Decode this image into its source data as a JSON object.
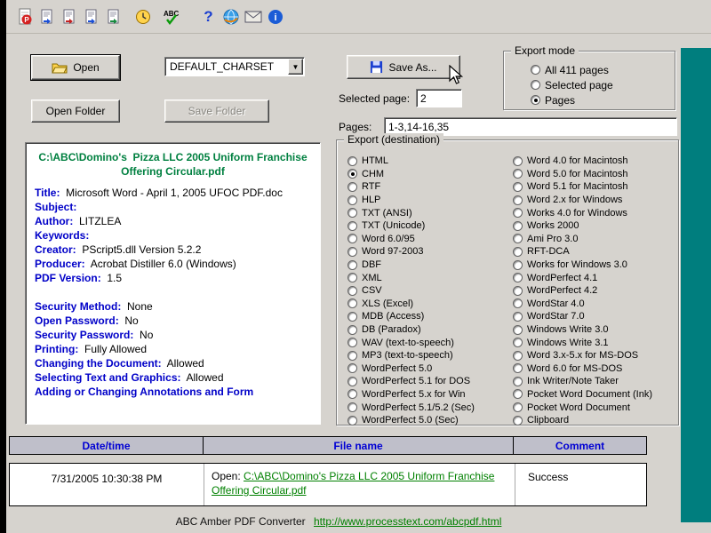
{
  "colors": {
    "desktop": "#008080",
    "window": "#d6d3ce",
    "info_label_blue": "#0000c8",
    "link_green": "#008000",
    "header_blue": "#0000d4"
  },
  "toolbar": {
    "icons": [
      "pdf-file-icon",
      "export-doc-icon-1",
      "export-doc-icon-2",
      "export-doc-icon-3",
      "export-doc-icon-4",
      "history-clock-icon",
      "spellcheck-abc-icon",
      "help-icon",
      "home-globe-icon",
      "mail-icon",
      "about-icon"
    ]
  },
  "controls": {
    "open": "Open",
    "open_folder": "Open Folder",
    "save_folder": "Save Folder",
    "save_as": "Save As...",
    "charset_value": "DEFAULT_CHARSET",
    "selected_page_label": "Selected page:",
    "selected_page_value": "2",
    "pages_label": "Pages:",
    "pages_value": "1-3,14-16,35"
  },
  "export_mode": {
    "legend": "Export mode",
    "options": [
      {
        "label": "All 411 pages",
        "selected": false
      },
      {
        "label": "Selected page",
        "selected": false
      },
      {
        "label": "Pages",
        "selected": true
      }
    ]
  },
  "export_destination": {
    "legend": "Export (destination)",
    "col1": [
      {
        "label": "HTML",
        "selected": false
      },
      {
        "label": "CHM",
        "selected": true
      },
      {
        "label": "RTF",
        "selected": false
      },
      {
        "label": "HLP",
        "selected": false
      },
      {
        "label": "TXT (ANSI)",
        "selected": false
      },
      {
        "label": "TXT (Unicode)",
        "selected": false
      },
      {
        "label": "Word 6.0/95",
        "selected": false
      },
      {
        "label": "Word 97-2003",
        "selected": false
      },
      {
        "label": "DBF",
        "selected": false
      },
      {
        "label": "XML",
        "selected": false
      },
      {
        "label": "CSV",
        "selected": false
      },
      {
        "label": "XLS (Excel)",
        "selected": false
      },
      {
        "label": "MDB (Access)",
        "selected": false
      },
      {
        "label": "DB (Paradox)",
        "selected": false
      },
      {
        "label": "WAV (text-to-speech)",
        "selected": false
      },
      {
        "label": "MP3 (text-to-speech)",
        "selected": false
      },
      {
        "label": "WordPerfect 5.0",
        "selected": false
      },
      {
        "label": "WordPerfect 5.1 for DOS",
        "selected": false
      },
      {
        "label": "WordPerfect 5.x for Win",
        "selected": false
      },
      {
        "label": "WordPerfect 5.1/5.2 (Sec)",
        "selected": false
      },
      {
        "label": "WordPerfect 5.0 (Sec)",
        "selected": false
      }
    ],
    "col2": [
      {
        "label": "Word 4.0 for Macintosh",
        "selected": false
      },
      {
        "label": "Word 5.0 for Macintosh",
        "selected": false
      },
      {
        "label": "Word 5.1 for Macintosh",
        "selected": false
      },
      {
        "label": "Word 2.x for Windows",
        "selected": false
      },
      {
        "label": "Works 4.0 for Windows",
        "selected": false
      },
      {
        "label": "Works 2000",
        "selected": false
      },
      {
        "label": "Ami Pro 3.0",
        "selected": false
      },
      {
        "label": "RFT-DCA",
        "selected": false
      },
      {
        "label": "Works for Windows 3.0",
        "selected": false
      },
      {
        "label": "WordPerfect 4.1",
        "selected": false
      },
      {
        "label": "WordPerfect 4.2",
        "selected": false
      },
      {
        "label": "WordStar 4.0",
        "selected": false
      },
      {
        "label": "WordStar 7.0",
        "selected": false
      },
      {
        "label": "Windows Write 3.0",
        "selected": false
      },
      {
        "label": "Windows Write 3.1",
        "selected": false
      },
      {
        "label": "Word 3.x-5.x for MS-DOS",
        "selected": false
      },
      {
        "label": "Word 6.0 for MS-DOS",
        "selected": false
      },
      {
        "label": "Ink Writer/Note Taker",
        "selected": false
      },
      {
        "label": "Pocket Word Document (Ink)",
        "selected": false
      },
      {
        "label": "Pocket Word Document",
        "selected": false
      },
      {
        "label": "Clipboard",
        "selected": false
      }
    ]
  },
  "info_panel": {
    "path": "C:\\ABC\\Domino's  Pizza LLC 2005 Uniform Franchise Offering Circular.pdf",
    "fields": [
      {
        "label": "Title:",
        "value": "Microsoft Word - April 1, 2005 UFOC PDF.doc"
      },
      {
        "label": "Subject:",
        "value": ""
      },
      {
        "label": "Author:",
        "value": "LITZLEA"
      },
      {
        "label": "Keywords:",
        "value": ""
      },
      {
        "label": "Creator:",
        "value": "PScript5.dll Version 5.2.2"
      },
      {
        "label": "Producer:",
        "value": "Acrobat Distiller 6.0 (Windows)"
      },
      {
        "label": "PDF Version:",
        "value": "1.5"
      },
      {
        "label": "",
        "value": ""
      },
      {
        "label": "Security Method:",
        "value": "None"
      },
      {
        "label": "Open Password:",
        "value": "No"
      },
      {
        "label": "Security Password:",
        "value": "No"
      },
      {
        "label": "Printing:",
        "value": "Fully Allowed"
      },
      {
        "label": "Changing the Document:",
        "value": "Allowed"
      },
      {
        "label": "Selecting Text and Graphics:",
        "value": "Allowed"
      },
      {
        "label": "Adding or Changing Annotations and Form",
        "value": ""
      }
    ]
  },
  "history": {
    "columns": [
      "Date/time",
      "File name",
      "Comment"
    ],
    "row": {
      "datetime": "7/31/2005 10:30:38 PM",
      "prefix": "Open: ",
      "link": "C:\\ABC\\Domino's  Pizza LLC 2005 Uniform Franchise Offering Circular.pdf",
      "comment": "Success"
    }
  },
  "footer": {
    "title": "ABC Amber PDF Converter",
    "link": "http://www.processtext.com/abcpdf.html"
  }
}
